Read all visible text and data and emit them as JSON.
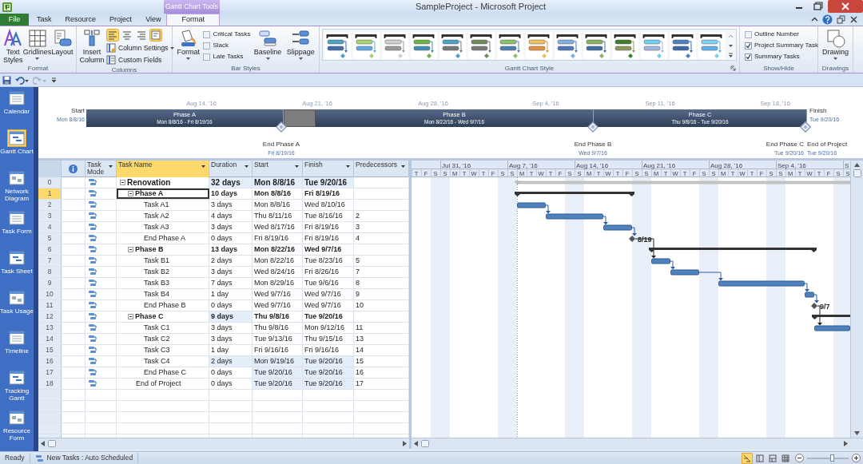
{
  "window": {
    "title": "SampleProject - Microsoft Project"
  },
  "ribbon": {
    "contextual_label": "Gantt Chart Tools",
    "tabs": [
      {
        "label": "File",
        "kind": "file",
        "selected": false
      },
      {
        "label": "Task",
        "kind": "normal",
        "selected": false
      },
      {
        "label": "Resource",
        "kind": "normal",
        "selected": false
      },
      {
        "label": "Project",
        "kind": "normal",
        "selected": false
      },
      {
        "label": "View",
        "kind": "normal",
        "selected": false
      },
      {
        "label": "Format",
        "kind": "contextual",
        "selected": true
      }
    ],
    "groups": [
      {
        "kind": "format",
        "label": "Format",
        "buttons": [
          {
            "label": "Text Styles",
            "kind": "text_styles",
            "dropdown": false
          },
          {
            "label": "Gridlines",
            "kind": "gridlines",
            "dropdown": true
          },
          {
            "label": "Layout",
            "kind": "layout",
            "dropdown": false
          }
        ]
      },
      {
        "kind": "columns",
        "label": "Columns",
        "insert": {
          "label": "Insert Column"
        },
        "align": [
          {
            "selected": true
          },
          {
            "selected": false
          },
          {
            "selected": false
          }
        ],
        "wrap": {
          "on": true
        },
        "commands": [
          {
            "label": "Column Settings",
            "dropdown": true
          },
          {
            "label": "Custom Fields",
            "dropdown": false
          }
        ]
      },
      {
        "kind": "bar_styles",
        "label": "Bar Styles",
        "format": {
          "label": "Format",
          "dropdown": true
        },
        "checkboxes": [
          {
            "label": "Critical Tasks",
            "checked": false
          },
          {
            "label": "Slack",
            "checked": false
          },
          {
            "label": "Late Tasks",
            "checked": false
          }
        ],
        "buttons": [
          {
            "label": "Baseline",
            "dropdown": true
          },
          {
            "label": "Slippage",
            "dropdown": true
          }
        ]
      },
      {
        "kind": "gantt_style",
        "label": "Gantt Chart Style"
      },
      {
        "kind": "show_hide",
        "label": "Show/Hide",
        "checkboxes": [
          {
            "label": "Outline Number",
            "checked": false
          },
          {
            "label": "Project Summary Task",
            "checked": true
          },
          {
            "label": "Summary Tasks",
            "checked": true
          }
        ]
      },
      {
        "kind": "drawings",
        "label": "Drawings",
        "button": {
          "label": "Drawing",
          "dropdown": true
        }
      }
    ]
  },
  "views": [
    {
      "label": "Calendar",
      "selected": false
    },
    {
      "label": "Gantt Chart",
      "selected": true
    },
    {
      "label": "Network Diagram",
      "selected": false
    },
    {
      "label": "Task Form",
      "selected": false
    },
    {
      "label": "Task Sheet",
      "selected": false
    },
    {
      "label": "Task Usage",
      "selected": false
    },
    {
      "label": "Timeline",
      "selected": false
    },
    {
      "label": "Tracking Gantt",
      "selected": false
    },
    {
      "label": "Resource Form",
      "selected": false
    }
  ],
  "timeline": {
    "start": {
      "label": "Start",
      "date": "Mon 8/8/16"
    },
    "finish": {
      "label": "Finish",
      "date": "Tue 9/20/16"
    },
    "ticks": [
      "Aug 14, '16",
      "Aug 21, '16",
      "Aug 28, '16",
      "Sep 4, '16",
      "Sep 11, '16",
      "Sep 18, '16"
    ],
    "phases": [
      {
        "name": "Phase A",
        "dates": "Mon 8/8/16 - Fri 8/19/16"
      },
      {
        "name": "Phase B",
        "dates": "Mon 8/22/16 - Wed 9/7/16"
      },
      {
        "name": "Phase C",
        "dates": "Thu 9/8/16 - Tue 9/20/16"
      }
    ],
    "milestones": [
      {
        "label": "End Phase A",
        "date": "Fri 8/19/16"
      },
      {
        "label": "End Phase B",
        "date": "Wed 9/7/16"
      },
      {
        "label": "End Phase C",
        "date": "Tue 9/20/16"
      },
      {
        "label": "End of Project",
        "date": "Tue 9/20/16"
      }
    ]
  },
  "table": {
    "columns": [
      {
        "label": "Task Mode",
        "selected": false
      },
      {
        "label": "Task Name",
        "selected": true
      },
      {
        "label": "Duration",
        "selected": false
      },
      {
        "label": "Start",
        "selected": false
      },
      {
        "label": "Finish",
        "selected": false
      },
      {
        "label": "Predecessors",
        "selected": false
      }
    ],
    "rows": [
      {
        "id": "0",
        "name": "Renovation",
        "kind": "project",
        "expanded": true,
        "selected": false,
        "duration": "32 days",
        "start": "Mon 8/8/16",
        "finish": "Tue 9/20/16",
        "changed": {
          "duration": true,
          "start": true,
          "finish": true
        },
        "children": [
          {
            "id": "1",
            "name": "Phase A",
            "kind": "summary",
            "expanded": true,
            "selected": true,
            "duration": "10 days",
            "start": "Mon 8/8/16",
            "finish": "Fri 8/19/16",
            "children": [
              {
                "id": "2",
                "name": "Task A1",
                "kind": "task",
                "selected": false,
                "duration": "3 days",
                "start": "Mon 8/8/16",
                "finish": "Wed 8/10/16"
              },
              {
                "id": "3",
                "name": "Task A2",
                "kind": "task",
                "selected": false,
                "duration": "4 days",
                "start": "Thu 8/11/16",
                "finish": "Tue 8/16/16",
                "predecessors": "2"
              },
              {
                "id": "4",
                "name": "Task A3",
                "kind": "task",
                "selected": false,
                "duration": "3 days",
                "start": "Wed 8/17/16",
                "finish": "Fri 8/19/16",
                "predecessors": "3"
              },
              {
                "id": "5",
                "name": "End Phase A",
                "kind": "task",
                "selected": false,
                "duration": "0 days",
                "start": "Fri 8/19/16",
                "finish": "Fri 8/19/16",
                "predecessors": "4"
              }
            ]
          },
          {
            "id": "6",
            "name": "Phase B",
            "kind": "summary",
            "expanded": true,
            "selected": false,
            "duration": "13 days",
            "start": "Mon 8/22/16",
            "finish": "Wed 9/7/16",
            "children": [
              {
                "id": "7",
                "name": "Task B1",
                "kind": "task",
                "selected": false,
                "duration": "2 days",
                "start": "Mon 8/22/16",
                "finish": "Tue 8/23/16",
                "predecessors": "5"
              },
              {
                "id": "8",
                "name": "Task B2",
                "kind": "task",
                "selected": false,
                "duration": "3 days",
                "start": "Wed 8/24/16",
                "finish": "Fri 8/26/16",
                "predecessors": "7"
              },
              {
                "id": "9",
                "name": "Task B3",
                "kind": "task",
                "selected": false,
                "duration": "7 days",
                "start": "Mon 8/29/16",
                "finish": "Tue 9/6/16",
                "predecessors": "8"
              },
              {
                "id": "10",
                "name": "Task B4",
                "kind": "task",
                "selected": false,
                "duration": "1 day",
                "start": "Wed 9/7/16",
                "finish": "Wed 9/7/16",
                "predecessors": "9"
              },
              {
                "id": "11",
                "name": "End Phase B",
                "kind": "task",
                "selected": false,
                "duration": "0 days",
                "start": "Wed 9/7/16",
                "finish": "Wed 9/7/16",
                "predecessors": "10"
              }
            ]
          },
          {
            "id": "12",
            "name": "Phase C",
            "kind": "summary",
            "expanded": true,
            "selected": false,
            "duration": "9 days",
            "start": "Thu 9/8/16",
            "finish": "Tue 9/20/16",
            "changed": {
              "duration": true
            },
            "children": [
              {
                "id": "13",
                "name": "Task C1",
                "kind": "task",
                "selected": false,
                "duration": "3 days",
                "start": "Thu 9/8/16",
                "finish": "Mon 9/12/16",
                "predecessors": "11"
              },
              {
                "id": "14",
                "name": "Task C2",
                "kind": "task",
                "selected": false,
                "duration": "3 days",
                "start": "Tue 9/13/16",
                "finish": "Thu 9/15/16",
                "predecessors": "13"
              },
              {
                "id": "15",
                "name": "Task C3",
                "kind": "task",
                "selected": false,
                "duration": "1 day",
                "start": "Fri 9/16/16",
                "finish": "Fri 9/16/16",
                "predecessors": "14"
              },
              {
                "id": "16",
                "name": "Task C4",
                "kind": "task",
                "selected": false,
                "duration": "2 days",
                "start": "Mon 9/19/16",
                "finish": "Tue 9/20/16",
                "predecessors": "15",
                "changed": {
                  "duration": true,
                  "start": true,
                  "finish": true
                }
              },
              {
                "id": "17",
                "name": "End Phase C",
                "kind": "task",
                "selected": false,
                "duration": "0 days",
                "start": "Tue 9/20/16",
                "finish": "Tue 9/20/16",
                "predecessors": "16",
                "changed": {
                  "start": true,
                  "finish": true
                }
              }
            ]
          },
          {
            "id": "18",
            "name": "End of Project",
            "kind": "task",
            "selected": false,
            "duration": "0 days",
            "start": "Tue 9/20/16",
            "finish": "Tue 9/20/16",
            "predecessors": "17",
            "changed": {
              "start": true,
              "finish": true
            }
          }
        ]
      }
    ]
  },
  "gantt": {
    "weeks": [
      "Jul 31, '16",
      "Aug 7, '16",
      "Aug 14, '16",
      "Aug 21, '16",
      "Aug 28, '16",
      "Sep 4, '16",
      "S"
    ],
    "days": [
      "T",
      "F",
      "S",
      "S",
      "M",
      "T",
      "W",
      "T",
      "F",
      "S",
      "S",
      "M",
      "T",
      "W",
      "T",
      "F",
      "S",
      "S",
      "M",
      "T",
      "W",
      "T",
      "F",
      "S",
      "S",
      "M",
      "T",
      "W",
      "T",
      "F",
      "S",
      "S",
      "M",
      "T",
      "W",
      "T",
      "F",
      "S",
      "S",
      "M",
      "T",
      "W",
      "T",
      "F",
      "S",
      "S"
    ],
    "milestone_labels": [
      "8/19",
      "9/7"
    ]
  },
  "status_bar": {
    "status": "Ready",
    "new_tasks": "New Tasks : Auto Scheduled",
    "views": [
      {
        "selected": true
      },
      {
        "selected": false
      },
      {
        "selected": false
      },
      {
        "selected": false
      }
    ],
    "zoom": {
      "level": 0.6
    }
  }
}
